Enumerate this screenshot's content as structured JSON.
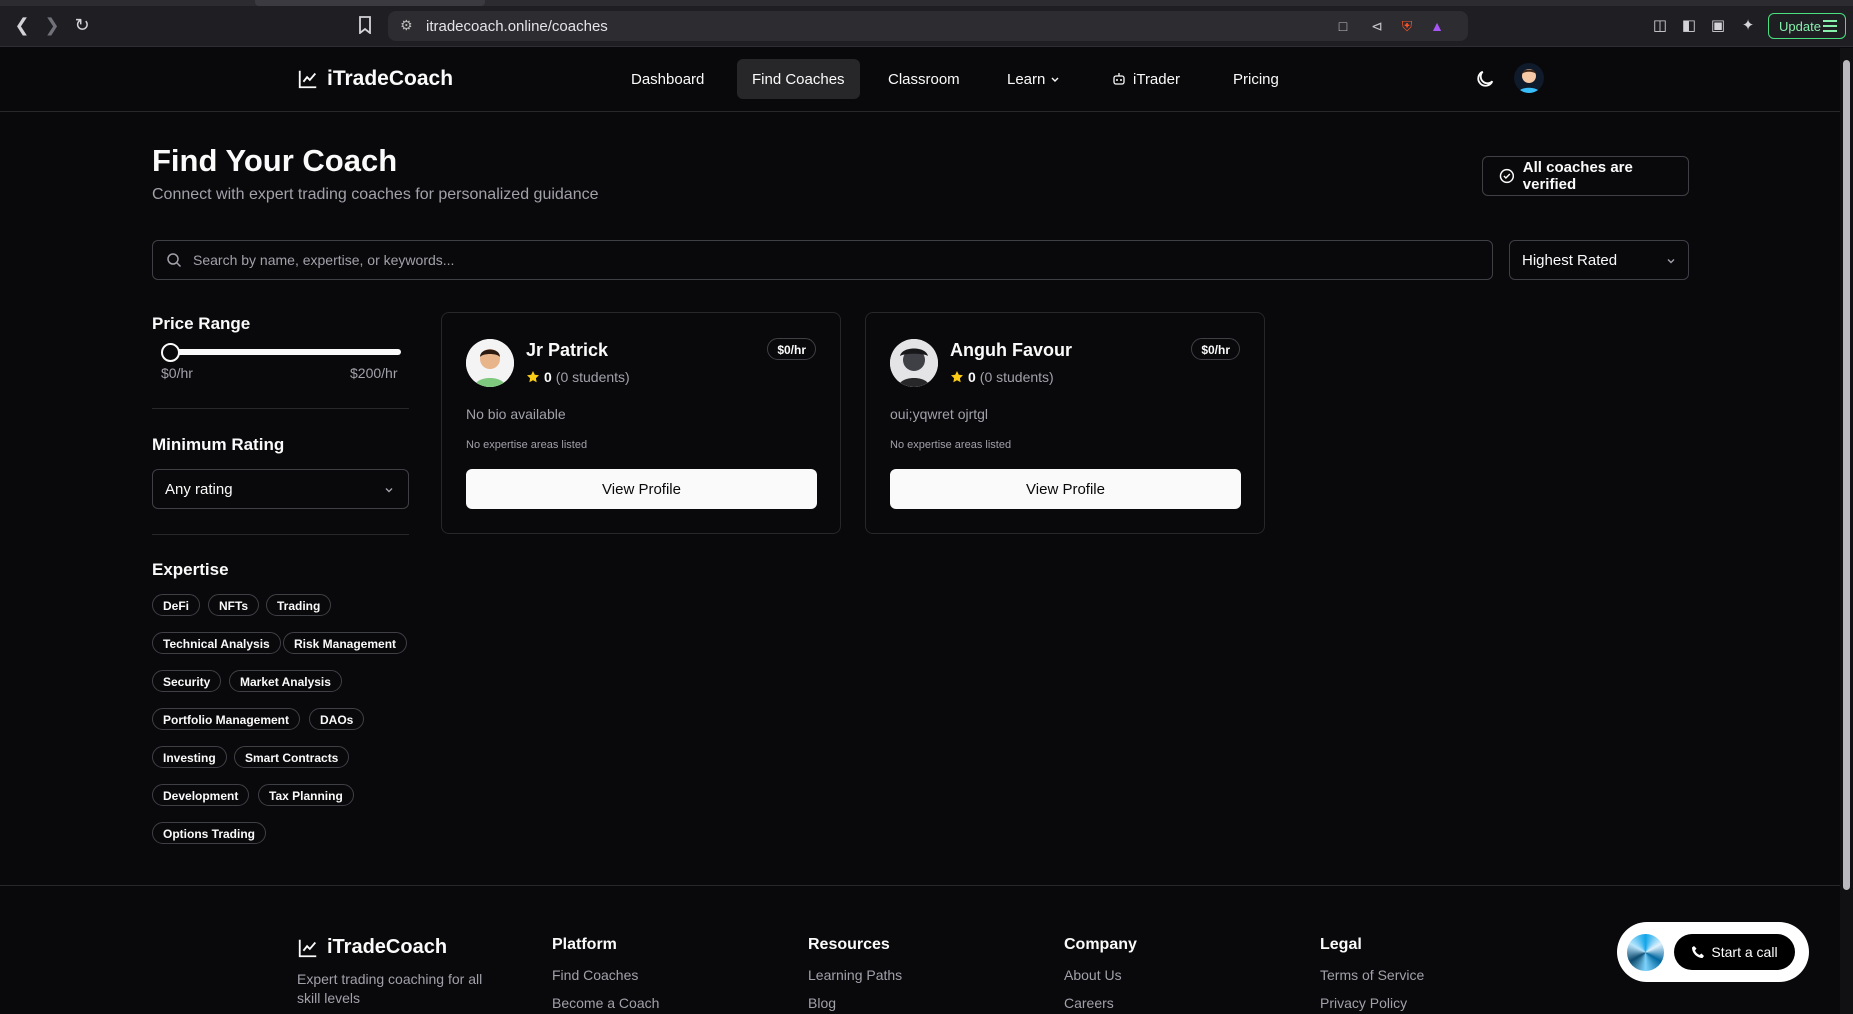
{
  "browser": {
    "url": "itradecoach.online/coaches",
    "update_label": "Update"
  },
  "header": {
    "brand": "iTradeCoach",
    "nav": [
      "Dashboard",
      "Find Coaches",
      "Classroom",
      "Learn",
      "iTrader",
      "Pricing"
    ],
    "active_nav": "Find Coaches"
  },
  "page": {
    "title": "Find Your Coach",
    "subtitle": "Connect with expert trading coaches for personalized guidance",
    "verified_badge": "All coaches are verified",
    "search_placeholder": "Search by name, expertise, or keywords...",
    "sort_value": "Highest Rated"
  },
  "filters": {
    "price_heading": "Price Range",
    "price_min_label": "$0/hr",
    "price_max_label": "$200/hr",
    "price_value": 0,
    "rating_heading": "Minimum Rating",
    "rating_value": "Any rating",
    "expertise_heading": "Expertise",
    "expertise": [
      "DeFi",
      "NFTs",
      "Trading",
      "Technical Analysis",
      "Risk Management",
      "Security",
      "Market Analysis",
      "Portfolio Management",
      "DAOs",
      "Investing",
      "Smart Contracts",
      "Development",
      "Tax Planning",
      "Options Trading"
    ]
  },
  "coaches": [
    {
      "name": "Jr Patrick",
      "rate": "$0/hr",
      "rating": "0",
      "students": "(0 students)",
      "bio": "No bio available",
      "expertise_note": "No expertise areas listed",
      "button": "View Profile"
    },
    {
      "name": "Anguh Favour",
      "rate": "$0/hr",
      "rating": "0",
      "students": "(0 students)",
      "bio": "oui;yqwret ojrtgl",
      "expertise_note": "No expertise areas listed",
      "button": "View Profile"
    }
  ],
  "footer": {
    "brand": "iTradeCoach",
    "tagline": "Expert trading coaching for all skill levels",
    "columns": [
      {
        "heading": "Platform",
        "links": [
          "Find Coaches",
          "Become a Coach"
        ]
      },
      {
        "heading": "Resources",
        "links": [
          "Learning Paths",
          "Blog"
        ]
      },
      {
        "heading": "Company",
        "links": [
          "About Us",
          "Careers"
        ]
      },
      {
        "heading": "Legal",
        "links": [
          "Terms of Service",
          "Privacy Policy"
        ]
      }
    ]
  },
  "call_widget": {
    "label": "Start a call"
  },
  "colors": {
    "background": "#09090b",
    "border": "#27272a",
    "star": "#facc15",
    "update_accent": "#4ade80"
  }
}
